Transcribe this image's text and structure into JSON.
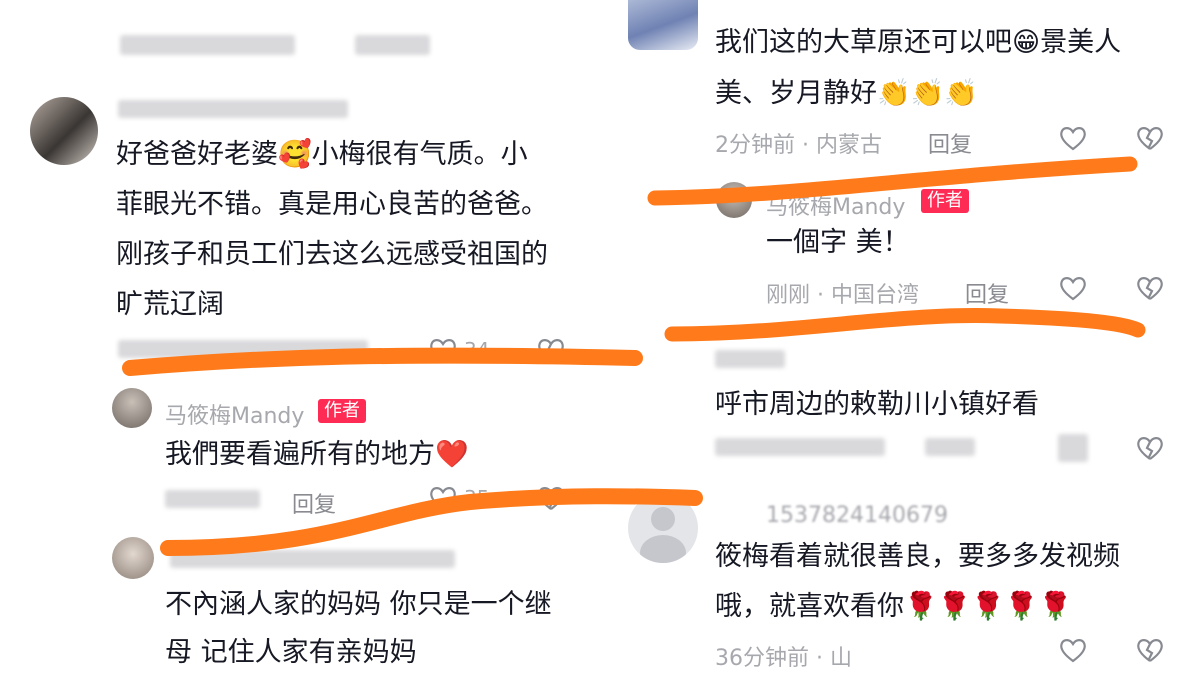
{
  "left_comments": {
    "c1": {
      "lines": [
        "好爸爸好老婆🥰小梅很有气质。小",
        "菲眼光不错。真是用心良苦的爸爸。",
        "刚孩子和员工们去这么远感受祖国的",
        "旷荒辽阔"
      ],
      "like_count": "34"
    },
    "c2": {
      "username": "马筱梅Mandy",
      "badge": "作者",
      "text": "我們要看遍所有的地方❤️",
      "reply": "回复",
      "like_count": "35"
    },
    "c3": {
      "lines": [
        "不內涵人家的妈妈 你只是一个继",
        "母 记住人家有亲妈妈"
      ]
    }
  },
  "right_comments": {
    "c1": {
      "lines": [
        "我们这的大草原还可以吧😁景美人",
        "美、岁月静好👏👏👏"
      ],
      "meta": "2分钟前 · 内蒙古",
      "reply": "回复"
    },
    "c2": {
      "username": "马筱梅Mandy",
      "badge": "作者",
      "text": "一個字 美！",
      "meta": "刚刚 · 中国台湾",
      "reply": "回复"
    },
    "c3": {
      "text": "呼市周边的敕勒川小镇好看"
    },
    "c4": {
      "username": "1537824140679",
      "lines": [
        "筱梅看着就很善良，要多多发视频",
        "哦，就喜欢看你🌹🌹🌹🌹🌹"
      ],
      "meta": "36分钟前 · 山"
    }
  },
  "colors": {
    "orange_marker": "#ff7a1a",
    "author_badge": "#fe2c55",
    "meta_gray": "#a7a8ad"
  }
}
